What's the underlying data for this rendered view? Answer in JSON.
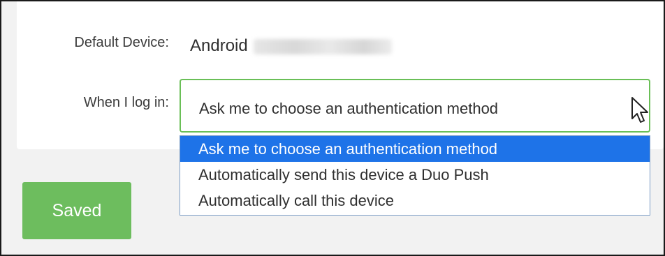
{
  "settings": {
    "default_device_label": "Default Device:",
    "default_device_value": "Android",
    "login_label": "When I log in:"
  },
  "login_select": {
    "selected_value": "Ask me to choose an authentication method",
    "options": [
      "Ask me to choose an authentication method",
      "Automatically send this device a Duo Push",
      "Automatically call this device"
    ],
    "highlighted_index": 0
  },
  "actions": {
    "saved_label": "Saved"
  },
  "colors": {
    "accent_green": "#6dbd5e",
    "select_border": "#6abf57",
    "option_highlight": "#1e73e8"
  },
  "icons": {
    "dropdown_arrow": "triangle-down",
    "cursor": "mouse-pointer"
  }
}
